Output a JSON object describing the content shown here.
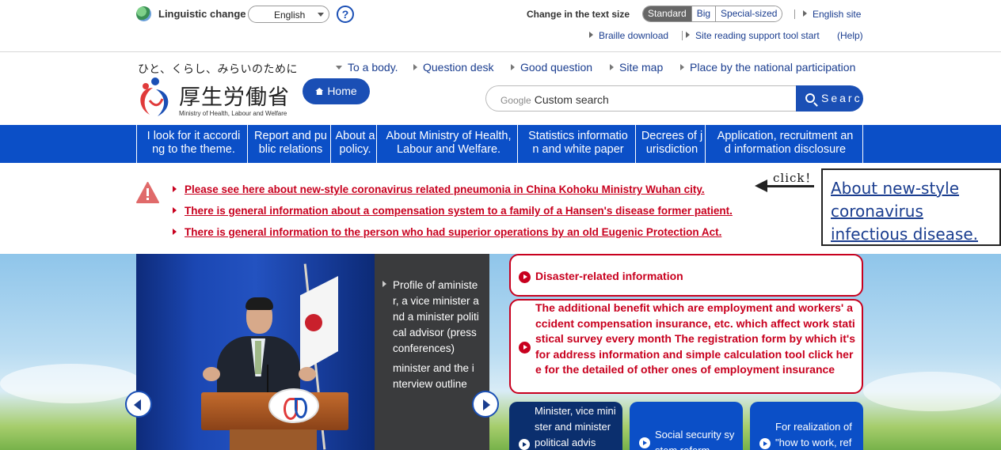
{
  "utility": {
    "linguistic_label": "Linguistic change",
    "language_value": "English",
    "help_label": "?",
    "text_size_label": "Change in the text size",
    "text_sizes": [
      "Standard",
      "Big",
      "Special-sized"
    ],
    "english_site": "English site",
    "braille": "Braille download",
    "reading_support": "Site reading support tool start",
    "help_link": "(Help)"
  },
  "header": {
    "tagline": "ひと、くらし、みらいのために",
    "logo_jp": "厚生労働省",
    "logo_en": "Ministry of Health, Labour and Welfare",
    "home": "Home",
    "links": [
      "To a body.",
      "Question desk",
      "Good question",
      "Site map",
      "Place by the national participation"
    ],
    "search_google": "Google",
    "search_placeholder": "Custom search",
    "search_button": "Searc"
  },
  "gnav": [
    "I look for it accordi\nng to the theme.",
    "Report and pu\nblic relations",
    "About a\npolicy.",
    "About Ministry of Health,\nLabour and Welfare.",
    "Statistics informatio\nn and white paper",
    "Decrees of j\nurisdiction",
    "Application, recruitment an\nd information disclosure"
  ],
  "alerts": [
    "Please see here about new-style coronavirus related pneumonia in China Kohoku Ministry Wuhan city.",
    "There is general information about a compensation system to a family of a Hansen's disease former patient.",
    "There is general information to the person who had superior operations by an old Eugenic Protection Act."
  ],
  "annotation": {
    "click": "click！",
    "callout": "About new-style coronavirus infectious disease."
  },
  "slider": {
    "text1": "Profile of aminister, a vice minister and a minister political advisor (press conferences)",
    "text2": "minister and the interview outline"
  },
  "red_boxes": [
    "Disaster-related information",
    "The additional benefit which are employment and workers' accident compensation insurance, etc. which affect work statistical survey every month The registration form by which it's for address information and simple calculation tool click here for the detailed of other ones of employment insurance"
  ],
  "tiles": [
    "Minister, vice minister and minister political advis",
    "Social security system reform",
    "For realization of \"how to work, ref"
  ],
  "colors": {
    "brand_blue": "#0b4fc7",
    "alert_red": "#c8001e",
    "link_blue": "#1a3d8f"
  }
}
